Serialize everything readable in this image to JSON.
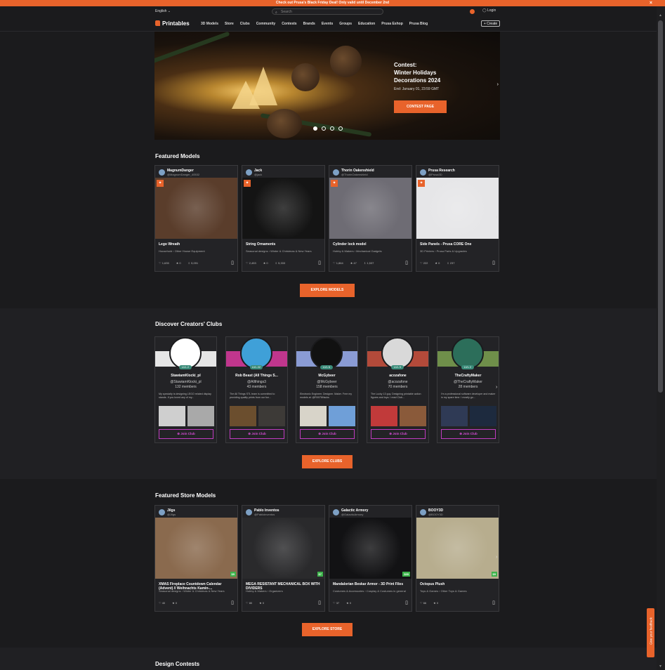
{
  "banner": {
    "text": "Check out Prusa's Black Friday Deal! Only valid until December 2nd",
    "close": "×"
  },
  "header": {
    "language": "English",
    "search_placeholder": "Search",
    "login": "Login",
    "logo": "Printables",
    "nav": [
      "3D Models",
      "Store",
      "Clubs",
      "Community",
      "Contests",
      "Brands",
      "Events",
      "Groups",
      "Education",
      "Prusa Eshop",
      "Prusa Blog"
    ],
    "create": "+ Create"
  },
  "hero": {
    "title_line1": "Contest:",
    "title_line2": "Winter Holidays",
    "title_line3": "Decorations 2024",
    "end": "End: January 01, 23:59 GMT",
    "button": "CONTEST PAGE",
    "active_dot": 0
  },
  "featured_models": {
    "heading": "Featured Models",
    "button": "EXPLORE MODELS",
    "items": [
      {
        "author": "MagnumDanger",
        "handle": "@MagnumDanger_40532",
        "title": "Lego Wreath",
        "cat1": "Household",
        "cat2": "Other House Equipment",
        "likes": "1,635",
        "boosts": "0",
        "downloads": "5,091",
        "color": "#5a3d2b"
      },
      {
        "author": "Jack",
        "handle": "@jack",
        "title": "String Ornaments",
        "cat1": "Seasonal designs",
        "cat2": "Winter & Christmas & New Years",
        "likes": "2,453",
        "boosts": "0",
        "downloads": "5,333",
        "color": "#141414"
      },
      {
        "author": "Thorin Oakenshield",
        "handle": "@ThorinOakenshield",
        "title": "Cylinder lock model",
        "cat1": "Hobby & Makers",
        "cat2": "Mechanical Gadgets",
        "likes": "1,864",
        "boosts": "47",
        "downloads": "1,537",
        "color": "#6e6c74"
      },
      {
        "author": "Prusa Research",
        "handle": "@Prusa3D",
        "title": "Side Panels - Prusa CORE One",
        "cat1": "3D Printers",
        "cat2": "Prusa Parts & Upgrades",
        "likes": "222",
        "boosts": "0",
        "downloads": "237",
        "color": "#e6e6e8"
      }
    ]
  },
  "clubs": {
    "heading": "Discover Creators' Clubs",
    "button": "EXPLORE CLUBS",
    "join": "Join Club",
    "items": [
      {
        "name": "StawiamKlocki_pl",
        "handle": "@StawiamKlocki_pl",
        "members": "132 members",
        "desc": "My specialty is designing LEGO related display stands. If you loved any of my...",
        "level": "LVL 2",
        "circle": "#ffffff"
      },
      {
        "name": "Rob Beast (All Things S...",
        "handle": "@Allthings3",
        "members": "43 members",
        "desc": "The All Things STL team is committed to providing quality prints from our fun...",
        "level": "LVL 22",
        "circle": "#3fa0d8"
      },
      {
        "name": "McGybeer",
        "handle": "@McGybeer",
        "members": "158 members",
        "desc": "Electronic Engineer. Designer. Maker. Free my models at: @R0076Hacks",
        "level": "LVL 6",
        "circle": "#111111"
      },
      {
        "name": "acozafone",
        "handle": "@acozafone",
        "members": "70 members",
        "desc": "The Lucky 13 guy. Designing printable action figures and toys. I read Club...",
        "level": "LVL 9",
        "circle": "#d9d9d9"
      },
      {
        "name": "TheCraftyMaker",
        "handle": "@TheCraftyMaker",
        "members": "28 members",
        "desc": "I'm a professional software developer and maker in my spare time. I mostly go...",
        "level": "LVL 2",
        "circle": "#2c6e5a"
      }
    ]
  },
  "store": {
    "heading": "Featured Store Models",
    "button": "EXPLORE STORE",
    "items": [
      {
        "author": "Jilgs",
        "handle": "@Jilgs",
        "title": "XMAS Fireplace Countdown Calendar (Advent) // Weihnachts Kamin-...",
        "cat1": "Seasonal designs",
        "cat2": "Winter & Christmas & New Years",
        "likes": "40",
        "boosts": "0",
        "price": "$5",
        "color": "#8a6a4e"
      },
      {
        "author": "Pablo Inventos",
        "handle": "@Pabloinventos",
        "title": "MEGA RESISTANT MECHANICAL BOX WITH DIVIDERS",
        "cat1": "Hobby & Makers",
        "cat2": "Organizers",
        "likes": "80",
        "boosts": "0",
        "price": "$7",
        "color": "#2a2a2c"
      },
      {
        "author": "Galactic Armory",
        "handle": "@GalacticArmory",
        "title": "Mandalorian Beskar Armor - 3D Print Files",
        "cat1": "Costumes & Accessories",
        "cat2": "Cosplay & Costumes in general",
        "likes": "37",
        "boosts": "0",
        "price": "$35",
        "color": "#121214"
      },
      {
        "author": "BOOY3D",
        "handle": "@BOOY3D",
        "title": "Octopus Plush",
        "cat1": "Toys & Games",
        "cat2": "Other Toys & Games",
        "likes": "66",
        "boosts": "0",
        "price": "$5",
        "color": "#b7ad8e"
      }
    ]
  },
  "design_contests": {
    "heading": "Design Contests"
  },
  "feedback": "Give your feedback"
}
